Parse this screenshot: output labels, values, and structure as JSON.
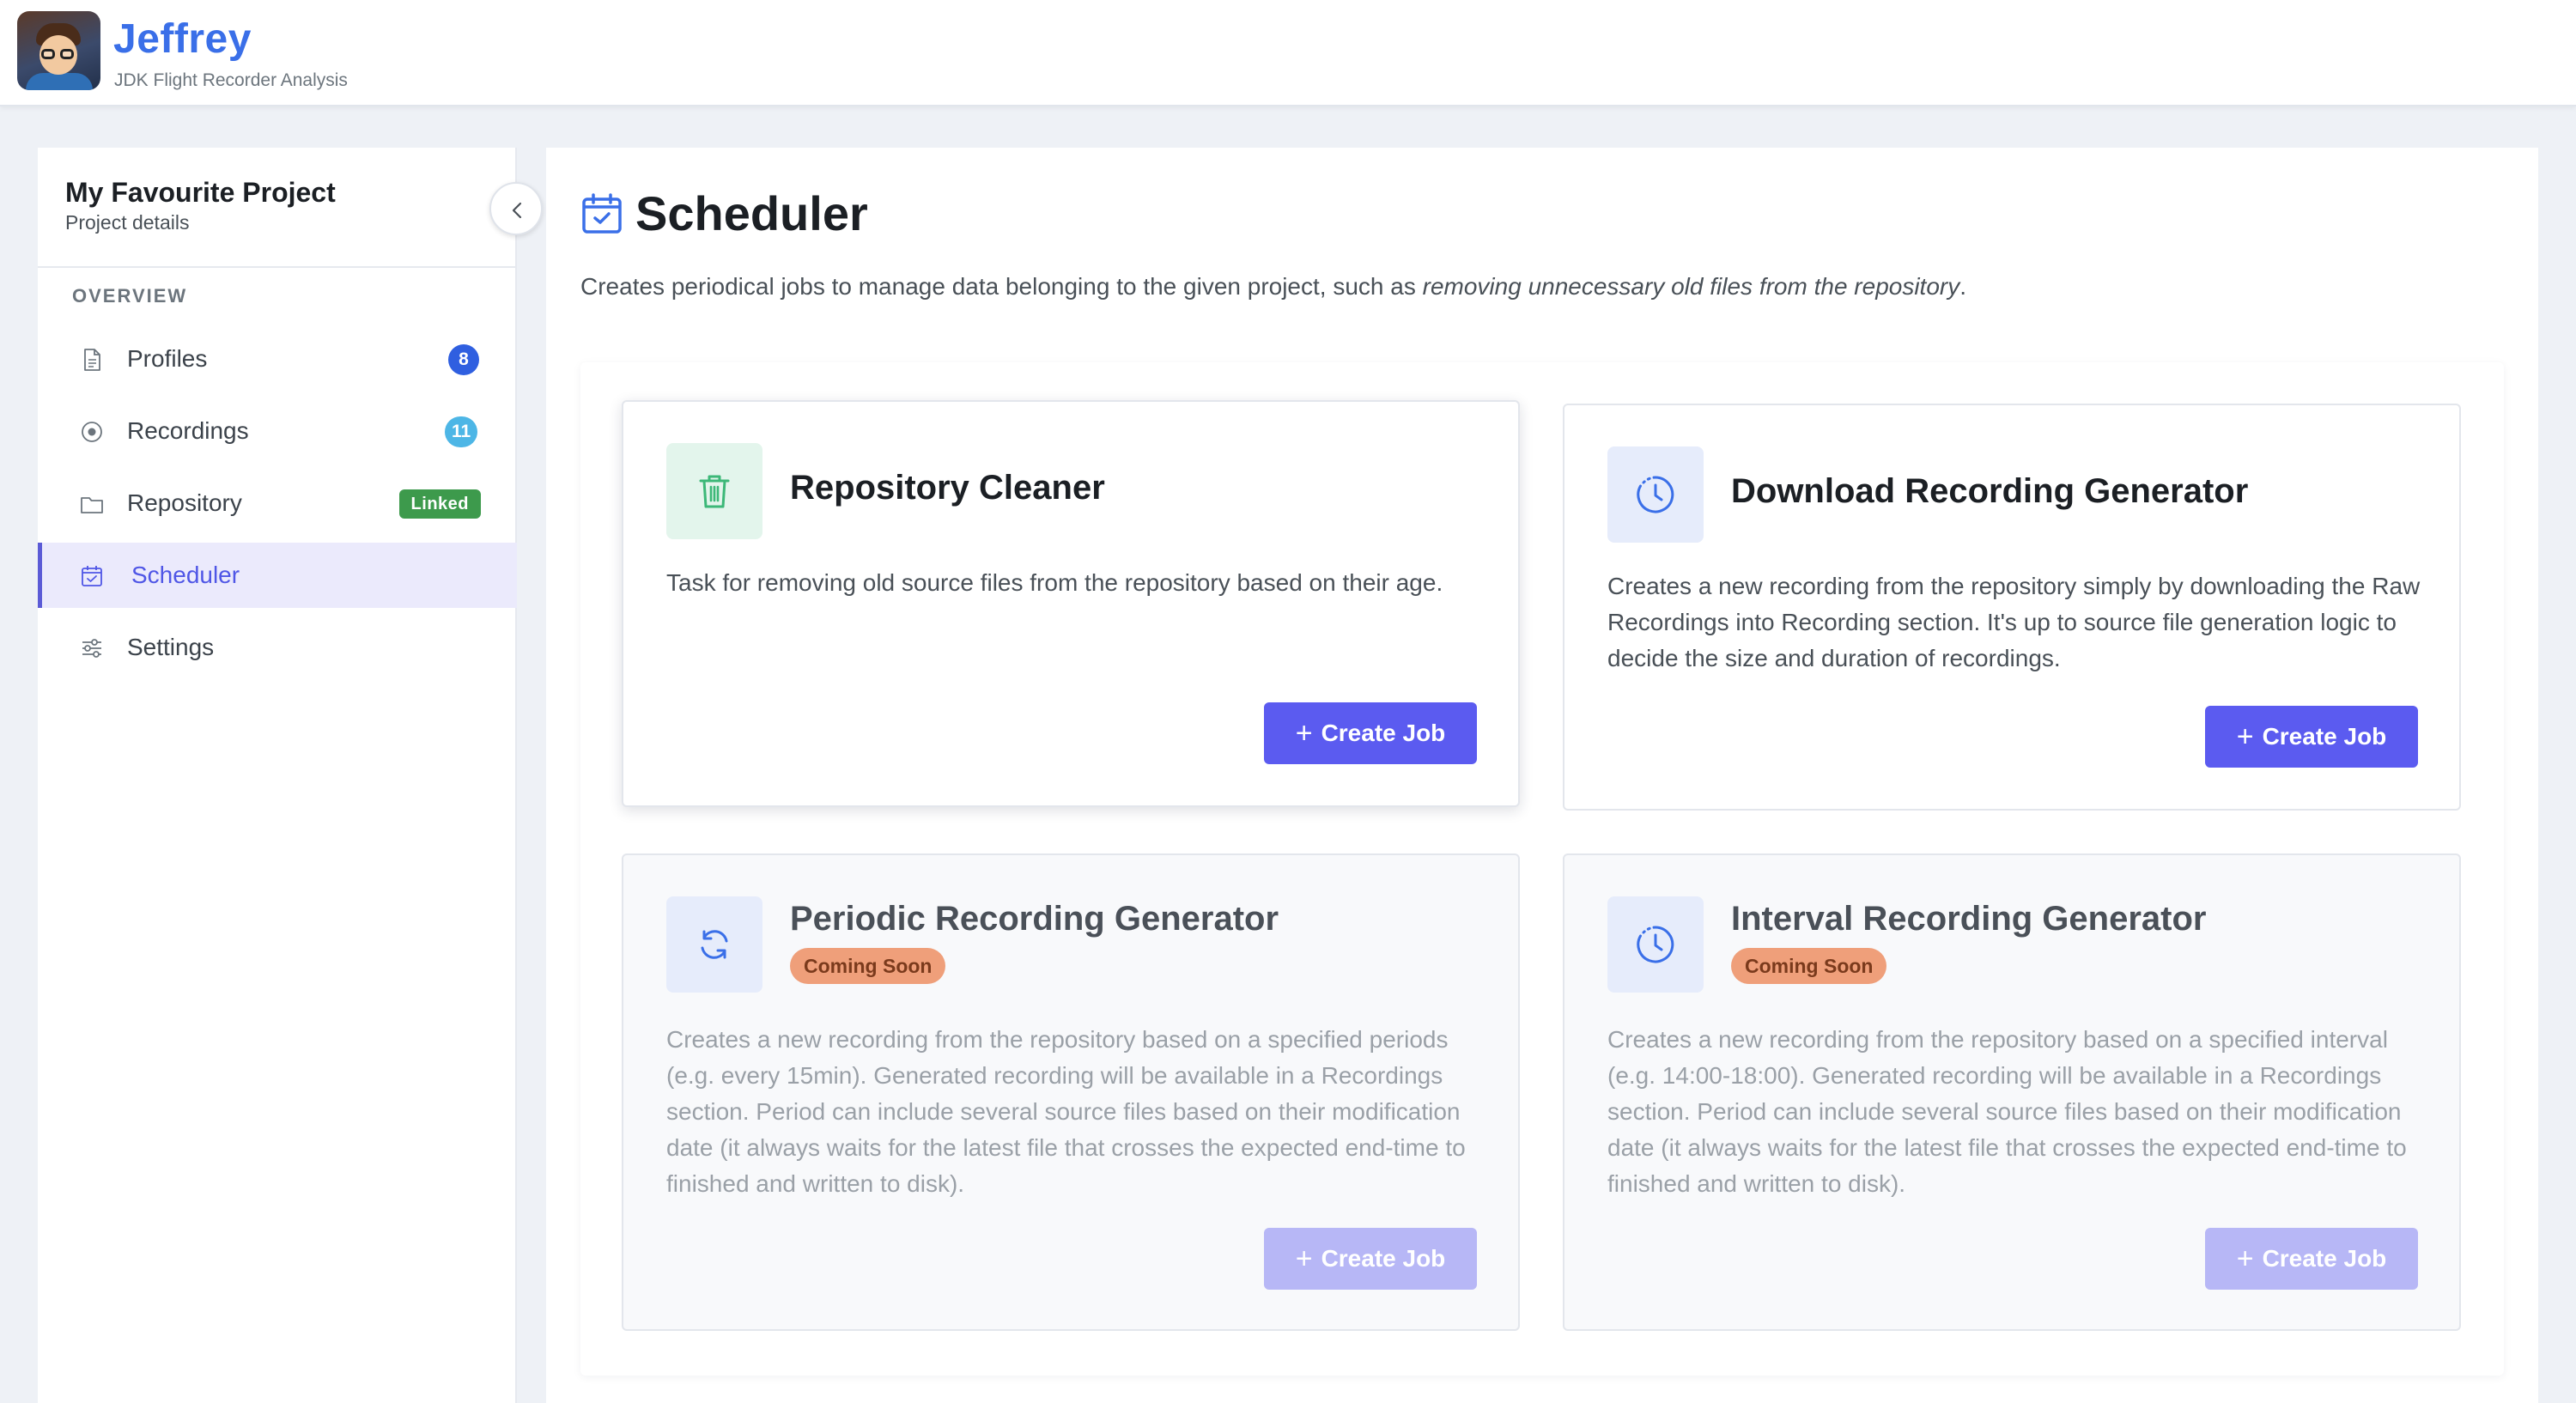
{
  "header": {
    "app_name": "Jeffrey",
    "app_subtitle": "JDK Flight Recorder Analysis"
  },
  "sidebar": {
    "project_title": "My Favourite Project",
    "project_subtitle": "Project details",
    "section_label": "OVERVIEW",
    "items": [
      {
        "label": "Profiles",
        "badge": "8",
        "badge_color": "#2f5fe0",
        "icon": "document-icon"
      },
      {
        "label": "Recordings",
        "badge": "11",
        "badge_color": "#4db6e6",
        "icon": "record-icon"
      },
      {
        "label": "Repository",
        "badge": "Linked",
        "badge_color": "#3d9a4c",
        "icon": "folder-icon"
      },
      {
        "label": "Scheduler",
        "active": true,
        "icon": "calendar-check-icon"
      },
      {
        "label": "Settings",
        "icon": "sliders-icon"
      }
    ]
  },
  "main": {
    "title": "Scheduler",
    "description_prefix": "Creates periodical jobs to manage data belonging to the given project, such as ",
    "description_emphasis": "removing unnecessary old files from the repository",
    "description_suffix": ".",
    "cards": [
      {
        "title": "Repository Cleaner",
        "icon": "trash-icon",
        "description": "Task for removing old source files from the repository based on their age.",
        "button": "Create Job",
        "enabled": true
      },
      {
        "title": "Download Recording Generator",
        "icon": "clock-icon",
        "description": "Creates a new recording from the repository simply by downloading the Raw Recordings into Recording section. It's up to source file generation logic to decide the size and duration of recordings.",
        "button": "Create Job",
        "enabled": true
      },
      {
        "title": "Periodic Recording Generator",
        "icon": "refresh-icon",
        "status": "Coming Soon",
        "description": "Creates a new recording from the repository based on a specified periods (e.g. every 15min). Generated recording will be available in a Recordings section. Period can include several source files based on their modification date (it always waits for the latest file that crosses the expected end-time to finished and written to disk).",
        "button": "Create Job",
        "enabled": false
      },
      {
        "title": "Interval Recording Generator",
        "icon": "clock-icon",
        "status": "Coming Soon",
        "description": "Creates a new recording from the repository based on a specified interval (e.g. 14:00-18:00). Generated recording will be available in a Recordings section. Period can include several source files based on their modification date (it always waits for the latest file that crosses the expected end-time to finished and written to disk).",
        "button": "Create Job",
        "enabled": false
      }
    ]
  },
  "colors": {
    "accent": "#5b5bf0",
    "brand": "#3a6fe8",
    "coming_soon": "#ef9f7a"
  }
}
